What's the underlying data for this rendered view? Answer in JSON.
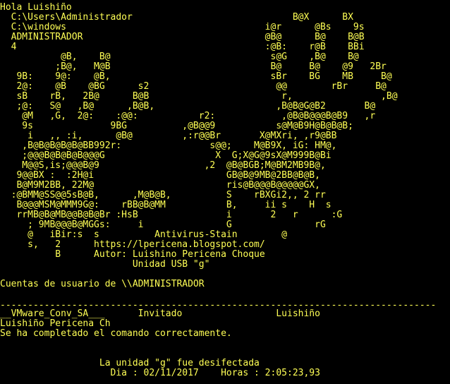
{
  "console": {
    "text_color": "#ffff55",
    "background_color": "#000000",
    "art_lines": [
      "Hola Luishiño",
      "  C:\\Users\\Administrador                             B@X      BX",
      "  C:\\windows                                    i@r      @Bs    9s",
      "  ADMINISTRADOR                                 @B@      B@    B@B",
      "  4                                             :@B:    r@B    BBi",
      "           @B,    B@                             s@G    ,B@    B@",
      "          ;B@,   M@B                             B@     B@    @9   2Br",
      "   9B:    9@:    @B,                             sBr    BG    MB     B@",
      "   2@:    @B    @BG      s2                       @@        rBr     B@",
      "   sB    rB,   2B@      B@B                        r,                ,B@",
      "   ;@:   S@   ,B@      ,B@B,                      ,B@B@G@B2       B@",
      "    @M   ,G,  2@:    :@@:           r2:            ,@B@B@@@B@B9   ,r",
      "    9s              9BG          ,@B@@9           s@M@B9H@B@B@B;",
      "     i   ,, :i,      @B@         ,:r@@Br       X@MXri, ,r9@BB",
      "    ,B@B@B@B@B@BB992r:                s@@;    M@B9X, iG: HM@,",
      "    ;@@@B@B@B@B@@@G                    X  G;X@G@9sX@M999B@Bi",
      "    M@@S,is;@@@B@9                   ,2  @B@BGB;M@BM2MB9B@,",
      "   9@@BX :  :2H@i                        GB@B@9MB@2BB@B@B,",
      "   B@M9M2BB, 22M@                        ris@B@@@B@@@@@GX,",
      "  :@BMM@SS@@5sB@B,      ,M@B@B,          S    rBXGi2,, 2 rr",
      "   B@@@MSM@MMM9G@:    rBB@B@MM           B,     ii s    H  s",
      "   rrMB@B@MB@@B@B@Br :HsB                i       2   r      :G",
      "     ; 9MB@@@B@MGGs:     i               G               rG",
      "     @   iBir:s  s          Antivirus-Stain        @",
      "     s,   2      https://lpericena.blogspot.com/",
      "          B      Autor: Luishino Pericena Choque",
      "                        Unidad USB \"g\""
    ],
    "accounts_header": "Cuentas de usuario de \\\\ADMINISTRADOR",
    "separator": "-------------------------------------------------------------------------------",
    "accounts_row": "__VMware_Conv_SA___      Invitado                 Luishiño",
    "accounts_row2": "Luishiño Pericena Ch",
    "command_result": "Se ha completado el comando correctamente.",
    "disinfect_message": "                  La unidad \"g\" fue desifectada",
    "date_time_line": "                    Dia : 02/11/2017    Horas : 2:05:23,93"
  }
}
